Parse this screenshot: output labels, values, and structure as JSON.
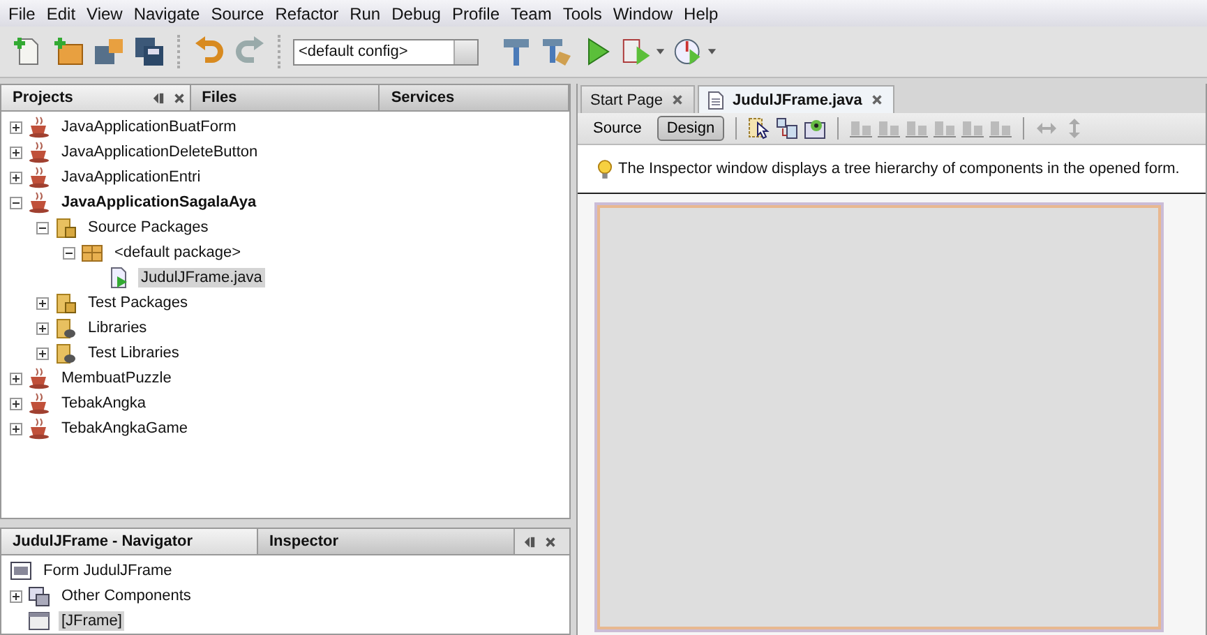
{
  "menu": [
    "File",
    "Edit",
    "View",
    "Navigate",
    "Source",
    "Refactor",
    "Run",
    "Debug",
    "Profile",
    "Team",
    "Tools",
    "Window",
    "Help"
  ],
  "toolbar": {
    "config": "<default config>"
  },
  "projects": {
    "tabs": [
      {
        "label": "Projects",
        "selected": true
      },
      {
        "label": "Files",
        "selected": false
      },
      {
        "label": "Services",
        "selected": false
      }
    ],
    "tree": [
      {
        "label": "JavaApplicationBuatForm",
        "kind": "project",
        "main": false,
        "expanded": false,
        "selected": false
      },
      {
        "label": "JavaApplicationDeleteButton",
        "kind": "project",
        "main": false,
        "expanded": false,
        "selected": false
      },
      {
        "label": "JavaApplicationEntri",
        "kind": "project",
        "main": false,
        "expanded": false,
        "selected": false
      },
      {
        "label": "JavaApplicationSagalaAya",
        "kind": "project",
        "main": true,
        "expanded": true,
        "selected": false,
        "children": [
          {
            "label": "Source Packages",
            "kind": "sources",
            "main": false,
            "expanded": true,
            "selected": false,
            "children": [
              {
                "label": "<default package>",
                "kind": "package",
                "main": false,
                "expanded": true,
                "selected": false,
                "children": [
                  {
                    "label": "JudulJFrame.java",
                    "kind": "java",
                    "main": false,
                    "selected": true
                  }
                ]
              }
            ]
          },
          {
            "label": "Test Packages",
            "kind": "sources",
            "main": false,
            "expanded": false,
            "selected": false
          },
          {
            "label": "Libraries",
            "kind": "library",
            "main": false,
            "expanded": false,
            "selected": false
          },
          {
            "label": "Test Libraries",
            "kind": "library",
            "main": false,
            "expanded": false,
            "selected": false
          }
        ]
      },
      {
        "label": "MembuatPuzzle",
        "kind": "project",
        "main": false,
        "expanded": false,
        "selected": false
      },
      {
        "label": "TebakAngka",
        "kind": "project",
        "main": false,
        "expanded": false,
        "selected": false
      },
      {
        "label": "TebakAngkaGame",
        "kind": "project",
        "main": false,
        "expanded": false,
        "selected": false
      }
    ]
  },
  "navigator": {
    "tabs": [
      {
        "label": "JudulJFrame - Navigator",
        "selected": true
      },
      {
        "label": "Inspector",
        "selected": false
      }
    ],
    "tree": [
      {
        "label": "Form JudulJFrame",
        "kind": "form",
        "main": false,
        "selected": false
      },
      {
        "label": "Other Components",
        "kind": "components",
        "main": false,
        "expanded": false,
        "selected": false
      },
      {
        "label": "[JFrame]",
        "kind": "frame",
        "main": false,
        "selected": true
      }
    ]
  },
  "editor": {
    "tabs": [
      {
        "label": "Start Page",
        "selected": false,
        "kind": "page"
      },
      {
        "label": "JudulJFrame.java",
        "selected": true,
        "kind": "file"
      }
    ],
    "views": [
      {
        "label": "Source",
        "selected": false
      },
      {
        "label": "Design",
        "selected": true
      }
    ],
    "hint": "The Inspector window displays a tree hierarchy of components in the opened form."
  }
}
